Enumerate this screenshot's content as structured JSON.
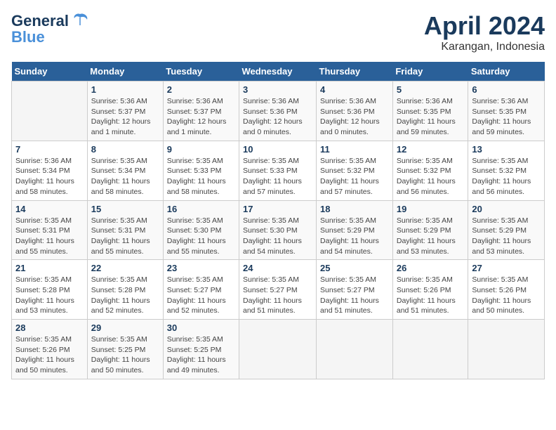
{
  "logo": {
    "part1": "General",
    "part2": "Blue"
  },
  "title": "April 2024",
  "location": "Karangan, Indonesia",
  "days_header": [
    "Sunday",
    "Monday",
    "Tuesday",
    "Wednesday",
    "Thursday",
    "Friday",
    "Saturday"
  ],
  "weeks": [
    [
      {
        "num": "",
        "info": ""
      },
      {
        "num": "1",
        "info": "Sunrise: 5:36 AM\nSunset: 5:37 PM\nDaylight: 12 hours\nand 1 minute."
      },
      {
        "num": "2",
        "info": "Sunrise: 5:36 AM\nSunset: 5:37 PM\nDaylight: 12 hours\nand 1 minute."
      },
      {
        "num": "3",
        "info": "Sunrise: 5:36 AM\nSunset: 5:36 PM\nDaylight: 12 hours\nand 0 minutes."
      },
      {
        "num": "4",
        "info": "Sunrise: 5:36 AM\nSunset: 5:36 PM\nDaylight: 12 hours\nand 0 minutes."
      },
      {
        "num": "5",
        "info": "Sunrise: 5:36 AM\nSunset: 5:35 PM\nDaylight: 11 hours\nand 59 minutes."
      },
      {
        "num": "6",
        "info": "Sunrise: 5:36 AM\nSunset: 5:35 PM\nDaylight: 11 hours\nand 59 minutes."
      }
    ],
    [
      {
        "num": "7",
        "info": "Sunrise: 5:36 AM\nSunset: 5:34 PM\nDaylight: 11 hours\nand 58 minutes."
      },
      {
        "num": "8",
        "info": "Sunrise: 5:35 AM\nSunset: 5:34 PM\nDaylight: 11 hours\nand 58 minutes."
      },
      {
        "num": "9",
        "info": "Sunrise: 5:35 AM\nSunset: 5:33 PM\nDaylight: 11 hours\nand 58 minutes."
      },
      {
        "num": "10",
        "info": "Sunrise: 5:35 AM\nSunset: 5:33 PM\nDaylight: 11 hours\nand 57 minutes."
      },
      {
        "num": "11",
        "info": "Sunrise: 5:35 AM\nSunset: 5:32 PM\nDaylight: 11 hours\nand 57 minutes."
      },
      {
        "num": "12",
        "info": "Sunrise: 5:35 AM\nSunset: 5:32 PM\nDaylight: 11 hours\nand 56 minutes."
      },
      {
        "num": "13",
        "info": "Sunrise: 5:35 AM\nSunset: 5:32 PM\nDaylight: 11 hours\nand 56 minutes."
      }
    ],
    [
      {
        "num": "14",
        "info": "Sunrise: 5:35 AM\nSunset: 5:31 PM\nDaylight: 11 hours\nand 55 minutes."
      },
      {
        "num": "15",
        "info": "Sunrise: 5:35 AM\nSunset: 5:31 PM\nDaylight: 11 hours\nand 55 minutes."
      },
      {
        "num": "16",
        "info": "Sunrise: 5:35 AM\nSunset: 5:30 PM\nDaylight: 11 hours\nand 55 minutes."
      },
      {
        "num": "17",
        "info": "Sunrise: 5:35 AM\nSunset: 5:30 PM\nDaylight: 11 hours\nand 54 minutes."
      },
      {
        "num": "18",
        "info": "Sunrise: 5:35 AM\nSunset: 5:29 PM\nDaylight: 11 hours\nand 54 minutes."
      },
      {
        "num": "19",
        "info": "Sunrise: 5:35 AM\nSunset: 5:29 PM\nDaylight: 11 hours\nand 53 minutes."
      },
      {
        "num": "20",
        "info": "Sunrise: 5:35 AM\nSunset: 5:29 PM\nDaylight: 11 hours\nand 53 minutes."
      }
    ],
    [
      {
        "num": "21",
        "info": "Sunrise: 5:35 AM\nSunset: 5:28 PM\nDaylight: 11 hours\nand 53 minutes."
      },
      {
        "num": "22",
        "info": "Sunrise: 5:35 AM\nSunset: 5:28 PM\nDaylight: 11 hours\nand 52 minutes."
      },
      {
        "num": "23",
        "info": "Sunrise: 5:35 AM\nSunset: 5:27 PM\nDaylight: 11 hours\nand 52 minutes."
      },
      {
        "num": "24",
        "info": "Sunrise: 5:35 AM\nSunset: 5:27 PM\nDaylight: 11 hours\nand 51 minutes."
      },
      {
        "num": "25",
        "info": "Sunrise: 5:35 AM\nSunset: 5:27 PM\nDaylight: 11 hours\nand 51 minutes."
      },
      {
        "num": "26",
        "info": "Sunrise: 5:35 AM\nSunset: 5:26 PM\nDaylight: 11 hours\nand 51 minutes."
      },
      {
        "num": "27",
        "info": "Sunrise: 5:35 AM\nSunset: 5:26 PM\nDaylight: 11 hours\nand 50 minutes."
      }
    ],
    [
      {
        "num": "28",
        "info": "Sunrise: 5:35 AM\nSunset: 5:26 PM\nDaylight: 11 hours\nand 50 minutes."
      },
      {
        "num": "29",
        "info": "Sunrise: 5:35 AM\nSunset: 5:25 PM\nDaylight: 11 hours\nand 50 minutes."
      },
      {
        "num": "30",
        "info": "Sunrise: 5:35 AM\nSunset: 5:25 PM\nDaylight: 11 hours\nand 49 minutes."
      },
      {
        "num": "",
        "info": ""
      },
      {
        "num": "",
        "info": ""
      },
      {
        "num": "",
        "info": ""
      },
      {
        "num": "",
        "info": ""
      }
    ]
  ]
}
